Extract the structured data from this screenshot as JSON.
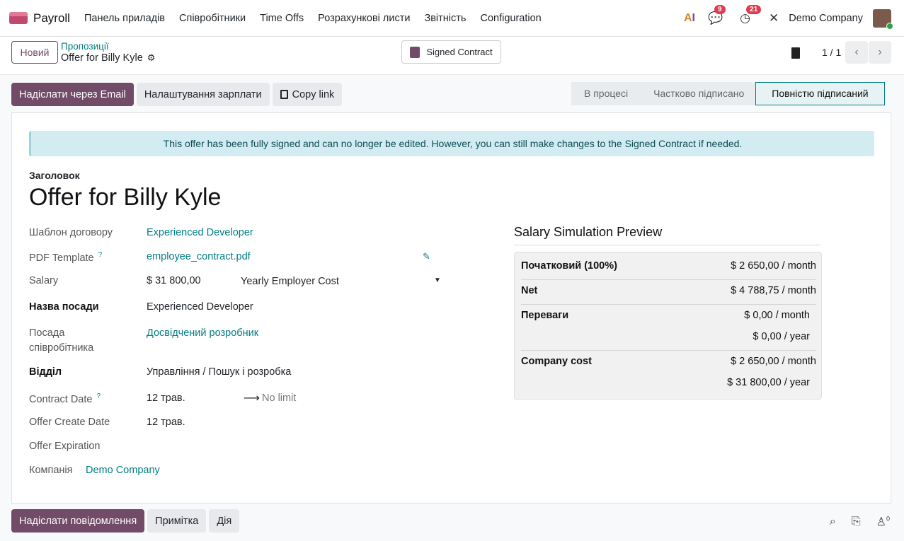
{
  "nav": {
    "app_name": "Payroll",
    "menu": [
      "Панель приладів",
      "Співробітники",
      "Time Offs",
      "Розрахункові листи",
      "Звітність",
      "Configuration"
    ],
    "messages_count": "9",
    "activities_count": "21",
    "company": "Demo Company"
  },
  "control": {
    "new_label": "Новий",
    "breadcrumb": "Пропозиції",
    "record_title": "Offer for Billy Kyle",
    "signed_contract_label": "Signed Contract",
    "pager": "1 / 1"
  },
  "actions": {
    "send_email": "Надіслати через Email",
    "salary_config": "Налаштування зарплати",
    "copy_link": "Copy link"
  },
  "status": {
    "stages": [
      "В процесі",
      "Частково підписано",
      "Повністю підписаний"
    ],
    "active": "Повністю підписаний"
  },
  "form": {
    "alert": "This offer has been fully signed and can no longer be edited. However, you can still make changes to the Signed Contract if needed.",
    "title_label": "Заголовок",
    "title": "Offer for Billy Kyle",
    "fields": {
      "template_label": "Шаблон договору",
      "template_value": "Experienced Developer",
      "pdf_label": "PDF Template",
      "pdf_help": "?",
      "pdf_value": "employee_contract.pdf",
      "salary_label": "Salary",
      "salary_value": "$ 31 800,00",
      "salary_period": "Yearly Employer Cost",
      "job_title_label": "Назва посади",
      "job_title_value": "Experienced Developer",
      "position_label_1": "Посада",
      "position_label_2": "співробітника",
      "position_value": "Досвідчений розробник",
      "department_label": "Відділ",
      "department_value": "Управління / Пошук і розробка",
      "contract_date_label": "Contract Date",
      "contract_date_help": "?",
      "contract_date_start": "12 трав.",
      "contract_date_end": "No limit",
      "offer_create_label": "Offer Create Date",
      "offer_create_value": "12 трав.",
      "offer_expiration_label": "Offer Expiration",
      "company_label": "Компанія",
      "company_value": "Demo Company"
    }
  },
  "preview": {
    "title": "Salary Simulation Preview",
    "rows": [
      {
        "label": "Початковий (100%)",
        "value": "$ 2 650,00 / month"
      },
      {
        "label": "Net",
        "value": "$ 4 788,75 / month"
      },
      {
        "label": "Переваги",
        "value": "$ 0,00 / month",
        "value2": "$ 0,00 / year"
      },
      {
        "label": "Company cost",
        "value": "$ 2 650,00 / month",
        "value2": "$ 31 800,00 / year"
      }
    ]
  },
  "chatter": {
    "send_message": "Надіслати повідомлення",
    "note": "Примітка",
    "activity": "Дія",
    "followers_count": "0"
  }
}
